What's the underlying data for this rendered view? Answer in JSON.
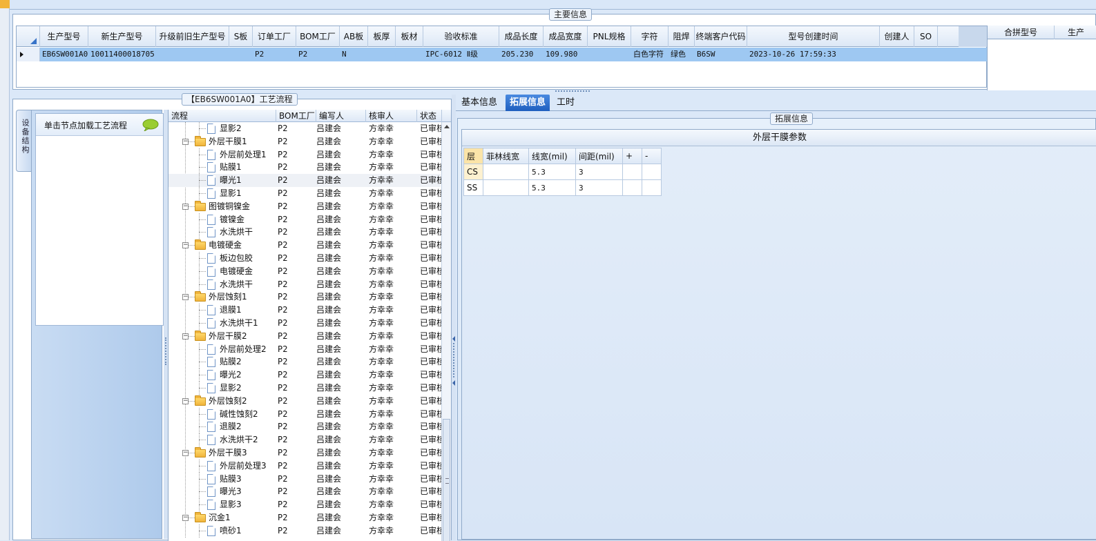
{
  "main_group_title": "主要信息",
  "main_grid": {
    "columns": [
      "生产型号",
      "新生产型号",
      "升级前旧生产型号",
      "S板",
      "订单工厂",
      "BOM工厂",
      "AB板",
      "板厚",
      "板材",
      "验收标准",
      "成品长度",
      "成品宽度",
      "PNL规格",
      "字符",
      "阻焊",
      "终端客户代码",
      "型号创建时间",
      "创建人",
      "SO"
    ],
    "row": [
      "EB6SW001A0",
      "10011400018705",
      "",
      "",
      "P2",
      "P2",
      "N",
      "",
      "",
      "IPC-6012 Ⅱ级",
      "205.230",
      "109.980",
      "",
      "白色字符",
      "绿色",
      "B6SW",
      "2023-10-26 17:59:33",
      "",
      ""
    ]
  },
  "merge_panel": {
    "columns": [
      "合拼型号",
      "生产"
    ]
  },
  "process_group_title": "【EB6SW001A0】工艺流程",
  "side_tab_label": "设备结构",
  "load_hint": "单击节点加载工艺流程",
  "tree": {
    "columns": [
      "流程",
      "BOM工厂",
      "编写人",
      "核审人",
      "状态"
    ],
    "rows": [
      {
        "name": "显影2",
        "level": 2,
        "type": "doc",
        "bom": "P2",
        "writer": "吕建会",
        "reviewer": "方幸幸",
        "status": "已审核"
      },
      {
        "name": "外层干膜1",
        "level": 1,
        "type": "folder",
        "bom": "P2",
        "writer": "吕建会",
        "reviewer": "方幸幸",
        "status": "已审核"
      },
      {
        "name": "外层前处理1",
        "level": 2,
        "type": "doc",
        "bom": "P2",
        "writer": "吕建会",
        "reviewer": "方幸幸",
        "status": "已审核"
      },
      {
        "name": "贴膜1",
        "level": 2,
        "type": "doc",
        "bom": "P2",
        "writer": "吕建会",
        "reviewer": "方幸幸",
        "status": "已审核"
      },
      {
        "name": "曝光1",
        "level": 2,
        "type": "doc",
        "bom": "P2",
        "writer": "吕建会",
        "reviewer": "方幸幸",
        "status": "已审核",
        "selected": true
      },
      {
        "name": "显影1",
        "level": 2,
        "type": "doc",
        "bom": "P2",
        "writer": "吕建会",
        "reviewer": "方幸幸",
        "status": "已审核"
      },
      {
        "name": "图镀铜镍金",
        "level": 1,
        "type": "folder",
        "bom": "P2",
        "writer": "吕建会",
        "reviewer": "方幸幸",
        "status": "已审核"
      },
      {
        "name": "镀镍金",
        "level": 2,
        "type": "doc",
        "bom": "P2",
        "writer": "吕建会",
        "reviewer": "方幸幸",
        "status": "已审核"
      },
      {
        "name": "水洗烘干",
        "level": 2,
        "type": "doc",
        "bom": "P2",
        "writer": "吕建会",
        "reviewer": "方幸幸",
        "status": "已审核"
      },
      {
        "name": "电镀硬金",
        "level": 1,
        "type": "folder",
        "bom": "P2",
        "writer": "吕建会",
        "reviewer": "方幸幸",
        "status": "已审核"
      },
      {
        "name": "板边包胶",
        "level": 2,
        "type": "doc",
        "bom": "P2",
        "writer": "吕建会",
        "reviewer": "方幸幸",
        "status": "已审核"
      },
      {
        "name": "电镀硬金",
        "level": 2,
        "type": "doc",
        "bom": "P2",
        "writer": "吕建会",
        "reviewer": "方幸幸",
        "status": "已审核"
      },
      {
        "name": "水洗烘干",
        "level": 2,
        "type": "doc",
        "bom": "P2",
        "writer": "吕建会",
        "reviewer": "方幸幸",
        "status": "已审核"
      },
      {
        "name": "外层蚀刻1",
        "level": 1,
        "type": "folder",
        "bom": "P2",
        "writer": "吕建会",
        "reviewer": "方幸幸",
        "status": "已审核"
      },
      {
        "name": "退膜1",
        "level": 2,
        "type": "doc",
        "bom": "P2",
        "writer": "吕建会",
        "reviewer": "方幸幸",
        "status": "已审核"
      },
      {
        "name": "水洗烘干1",
        "level": 2,
        "type": "doc",
        "bom": "P2",
        "writer": "吕建会",
        "reviewer": "方幸幸",
        "status": "已审核"
      },
      {
        "name": "外层干膜2",
        "level": 1,
        "type": "folder",
        "bom": "P2",
        "writer": "吕建会",
        "reviewer": "方幸幸",
        "status": "已审核"
      },
      {
        "name": "外层前处理2",
        "level": 2,
        "type": "doc",
        "bom": "P2",
        "writer": "吕建会",
        "reviewer": "方幸幸",
        "status": "已审核"
      },
      {
        "name": "贴膜2",
        "level": 2,
        "type": "doc",
        "bom": "P2",
        "writer": "吕建会",
        "reviewer": "方幸幸",
        "status": "已审核"
      },
      {
        "name": "曝光2",
        "level": 2,
        "type": "doc",
        "bom": "P2",
        "writer": "吕建会",
        "reviewer": "方幸幸",
        "status": "已审核"
      },
      {
        "name": "显影2",
        "level": 2,
        "type": "doc",
        "bom": "P2",
        "writer": "吕建会",
        "reviewer": "方幸幸",
        "status": "已审核"
      },
      {
        "name": "外层蚀刻2",
        "level": 1,
        "type": "folder",
        "bom": "P2",
        "writer": "吕建会",
        "reviewer": "方幸幸",
        "status": "已审核"
      },
      {
        "name": "碱性蚀刻2",
        "level": 2,
        "type": "doc",
        "bom": "P2",
        "writer": "吕建会",
        "reviewer": "方幸幸",
        "status": "已审核"
      },
      {
        "name": "退膜2",
        "level": 2,
        "type": "doc",
        "bom": "P2",
        "writer": "吕建会",
        "reviewer": "方幸幸",
        "status": "已审核"
      },
      {
        "name": "水洗烘干2",
        "level": 2,
        "type": "doc",
        "bom": "P2",
        "writer": "吕建会",
        "reviewer": "方幸幸",
        "status": "已审核"
      },
      {
        "name": "外层干膜3",
        "level": 1,
        "type": "folder",
        "bom": "P2",
        "writer": "吕建会",
        "reviewer": "方幸幸",
        "status": "已审核"
      },
      {
        "name": "外层前处理3",
        "level": 2,
        "type": "doc",
        "bom": "P2",
        "writer": "吕建会",
        "reviewer": "方幸幸",
        "status": "已审核"
      },
      {
        "name": "贴膜3",
        "level": 2,
        "type": "doc",
        "bom": "P2",
        "writer": "吕建会",
        "reviewer": "方幸幸",
        "status": "已审核"
      },
      {
        "name": "曝光3",
        "level": 2,
        "type": "doc",
        "bom": "P2",
        "writer": "吕建会",
        "reviewer": "方幸幸",
        "status": "已审核"
      },
      {
        "name": "显影3",
        "level": 2,
        "type": "doc",
        "bom": "P2",
        "writer": "吕建会",
        "reviewer": "方幸幸",
        "status": "已审核"
      },
      {
        "name": "沉金1",
        "level": 1,
        "type": "folder",
        "bom": "P2",
        "writer": "吕建会",
        "reviewer": "方幸幸",
        "status": "已审核"
      },
      {
        "name": "喷砂1",
        "level": 2,
        "type": "doc",
        "bom": "P2",
        "writer": "吕建会",
        "reviewer": "方幸幸",
        "status": "已审核"
      }
    ]
  },
  "right_tabs": [
    {
      "label": "基本信息",
      "active": false
    },
    {
      "label": "拓展信息",
      "active": true
    },
    {
      "label": "工时",
      "active": false
    }
  ],
  "ext_group_title": "拓展信息",
  "film_params": {
    "title": "外层干膜参数",
    "columns": [
      "层",
      "菲林线宽",
      "线宽(mil)",
      "间距(mil)",
      "+",
      "-"
    ],
    "rows": [
      [
        "CS",
        "",
        "5.3",
        "3",
        "",
        ""
      ],
      [
        "SS",
        "",
        "5.3",
        "3",
        "",
        ""
      ]
    ]
  },
  "colors": {
    "accent": "#1f5fbf",
    "selection": "#9ec8f2",
    "background": "#dbe8f8",
    "highlight": "#fbe4a8"
  }
}
